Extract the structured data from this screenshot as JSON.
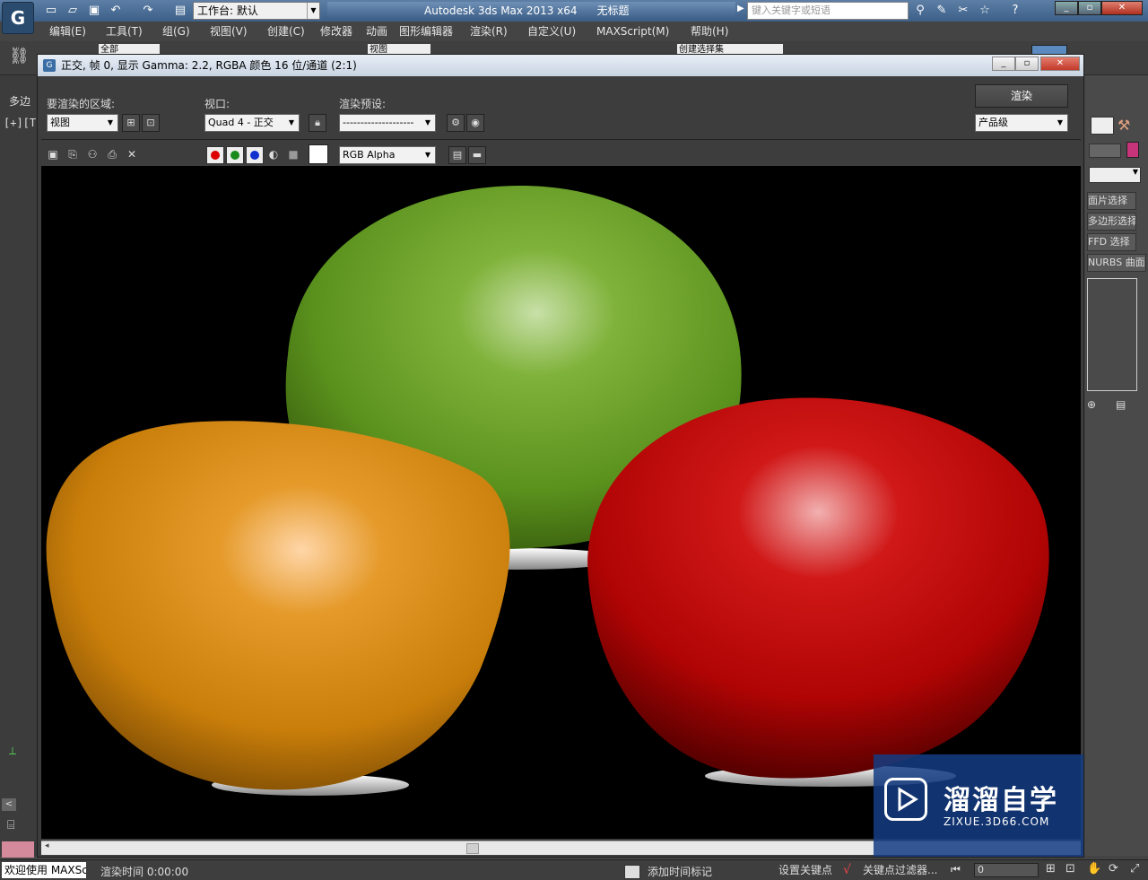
{
  "app": {
    "workspace": "工作台: 默认",
    "title": "Autodesk 3ds Max  2013 x64",
    "doc_title": "无标题",
    "search_placeholder": "键入关键字或短语"
  },
  "menu": [
    "编辑(E)",
    "工具(T)",
    "组(G)",
    "视图(V)",
    "创建(C)",
    "修改器",
    "动画",
    "图形编辑器",
    "渲染(R)",
    "自定义(U)",
    "MAXScript(M)",
    "帮助(H)"
  ],
  "toolbar": {
    "selection_filter": "全部",
    "ref_coord": "视图",
    "named_selection": "创建选择集"
  },
  "left": {
    "tab": "多边",
    "viewport_label": "[+][T"
  },
  "right_panel": [
    "面片选择",
    "多边形选择",
    "FFD 选择",
    "NURBS 曲面选择"
  ],
  "render_window": {
    "title": "正交, 帧 0, 显示 Gamma: 2.2, RGBA 颜色 16 位/通道 (2:1)",
    "area_label": "要渲染的区域:",
    "area_value": "视图",
    "viewport_label": "视口:",
    "viewport_value": "Quad 4 - 正交",
    "preset_label": "渲染预设:",
    "preset_value": "--------------------",
    "render_button": "渲染",
    "quality_value": "产品级",
    "channel_value": "RGB Alpha"
  },
  "status": {
    "welcome": "欢迎使用 MAXSc",
    "render_time": "渲染时间  0:00:00",
    "add_time_tag": "添加时间标记",
    "set_key": "设置关键点",
    "key_filters": "关键点过滤器...",
    "frame_value": "0"
  },
  "watermark": {
    "title": "溜溜自学",
    "subtitle": "ZIXUE.3D66.COM"
  },
  "colors": {
    "chair_orange": "#d98a10",
    "chair_green": "#5f9a20",
    "chair_red": "#c00808",
    "accent_blue": "#3c5f88"
  }
}
